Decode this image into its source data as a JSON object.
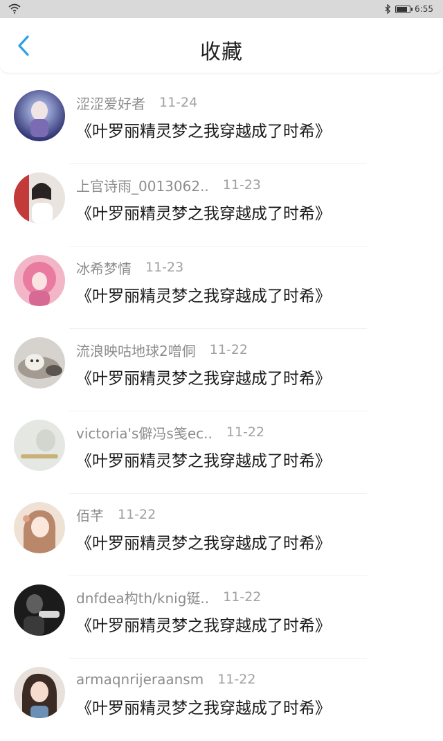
{
  "status_bar": {
    "time": "6:55"
  },
  "header": {
    "title": "收藏",
    "back_icon": "chevron-left-icon",
    "accent": "#2f9ee8"
  },
  "items": [
    {
      "name": "涩涩爱好者",
      "date": "11-24",
      "book": "《叶罗丽精灵梦之我穿越成了时希》"
    },
    {
      "name": "上官诗雨_0013062..",
      "date": "11-23",
      "book": "《叶罗丽精灵梦之我穿越成了时希》"
    },
    {
      "name": "冰希梦情",
      "date": "11-23",
      "book": "《叶罗丽精灵梦之我穿越成了时希》"
    },
    {
      "name": "流浪映咕地球2噌侗",
      "date": "11-22",
      "book": "《叶罗丽精灵梦之我穿越成了时希》"
    },
    {
      "name": "victoria's僻冯s笺ec..",
      "date": "11-22",
      "book": "《叶罗丽精灵梦之我穿越成了时希》"
    },
    {
      "name": "佰芊",
      "date": "11-22",
      "book": "《叶罗丽精灵梦之我穿越成了时希》"
    },
    {
      "name": "dnfdea构th/knig铤..",
      "date": "11-22",
      "book": "《叶罗丽精灵梦之我穿越成了时希》"
    },
    {
      "name": "armaqnrijeraansm",
      "date": "11-22",
      "book": "《叶罗丽精灵梦之我穿越成了时希》"
    }
  ]
}
